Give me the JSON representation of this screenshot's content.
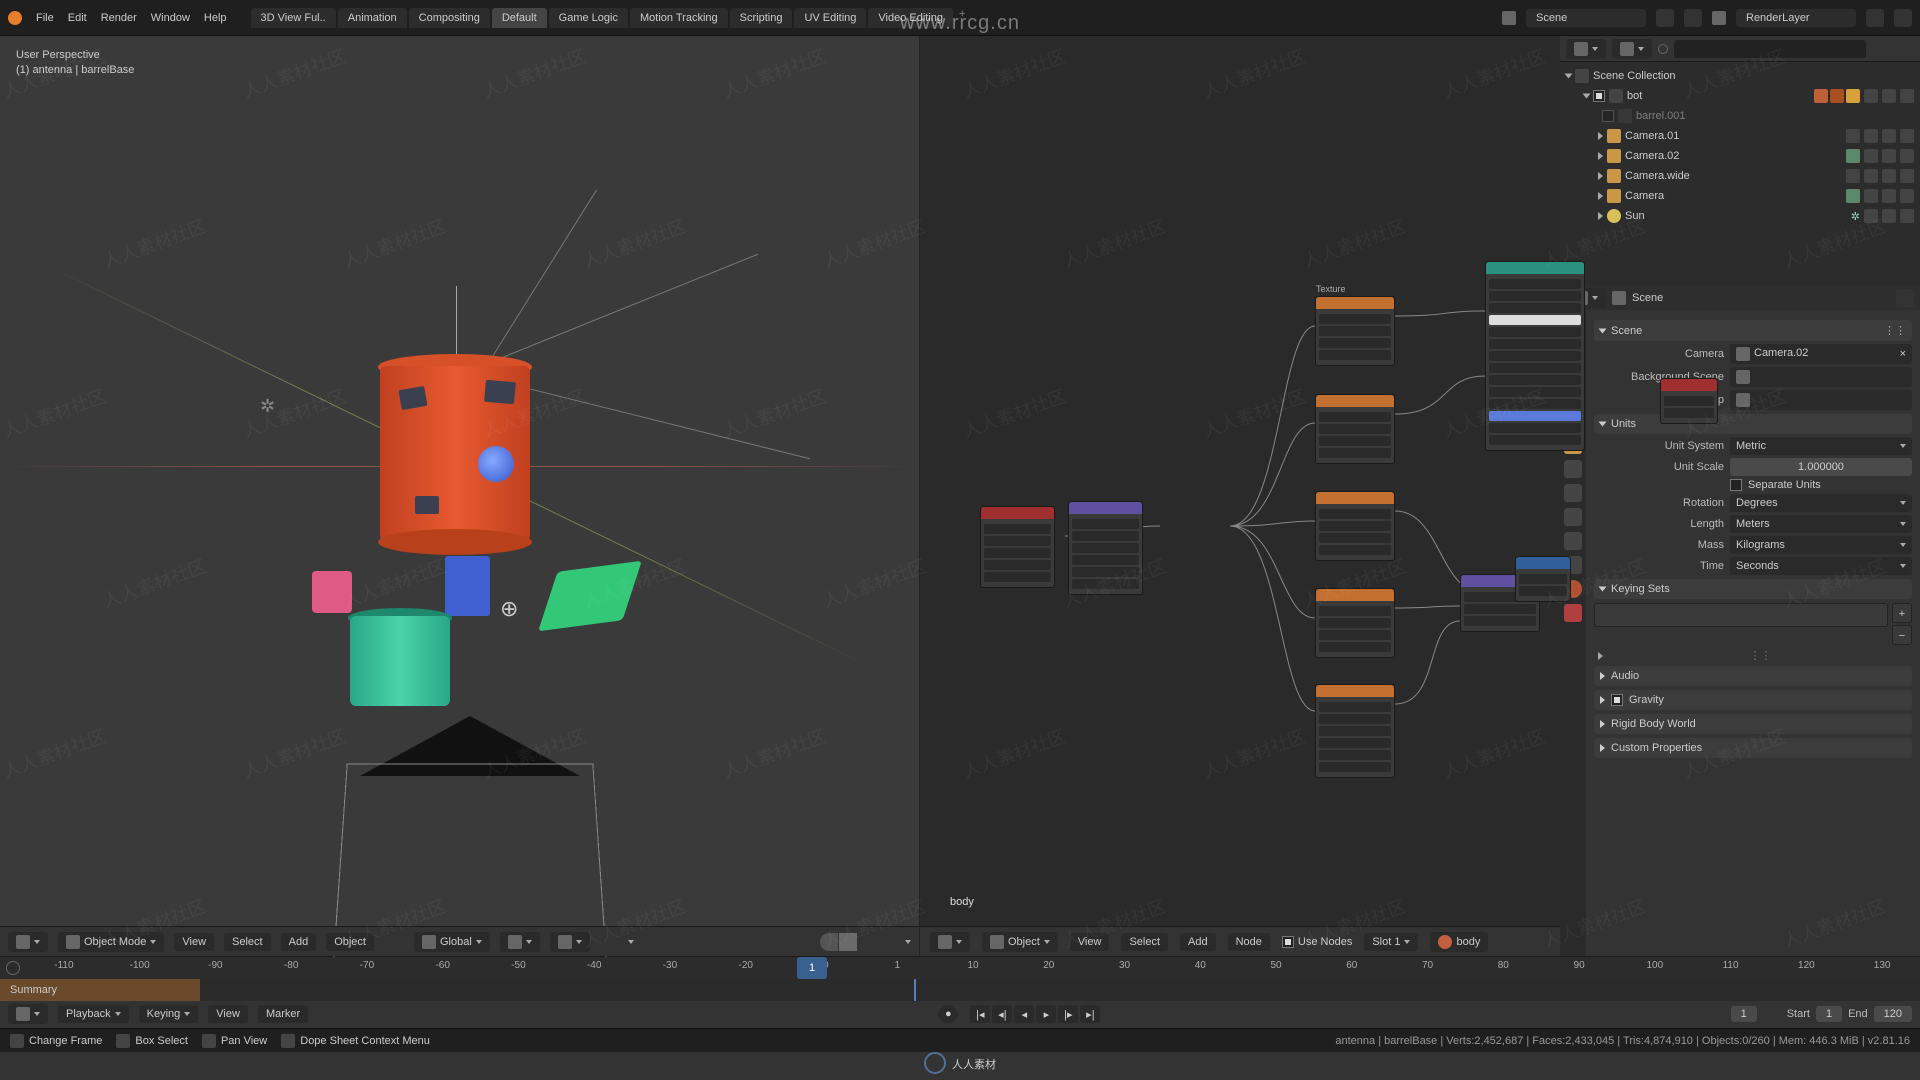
{
  "watermark": {
    "url": "www.rrcg.cn",
    "logo": "人人素材"
  },
  "topbar": {
    "menus": [
      "File",
      "Edit",
      "Render",
      "Window",
      "Help"
    ],
    "workspaces": [
      "3D View Ful..",
      "Animation",
      "Compositing",
      "Default",
      "Game Logic",
      "Motion Tracking",
      "Scripting",
      "UV Editing",
      "Video Editing"
    ],
    "active_workspace": "Default",
    "scene_label": "Scene",
    "renderlayer_label": "RenderLayer"
  },
  "viewport": {
    "persp": "User Perspective",
    "selection": "(1) antenna | barrelBase",
    "header": {
      "mode": "Object Mode",
      "menus": [
        "View",
        "Select",
        "Add",
        "Object"
      ],
      "orientation": "Global"
    }
  },
  "node_editor": {
    "material_label": "body",
    "header": {
      "type": "Object",
      "menus": [
        "View",
        "Select",
        "Add",
        "Node"
      ],
      "use_nodes_label": "Use Nodes",
      "use_nodes": true,
      "slot": "Slot 1",
      "material": "body"
    },
    "group_label": "Texture"
  },
  "outliner": {
    "root": "Scene Collection",
    "items": [
      {
        "indent": 1,
        "name": "bot",
        "checked": true,
        "icons": 3,
        "ctrls": true
      },
      {
        "indent": 2,
        "name": "barrel.001",
        "checked": false,
        "muted": true
      },
      {
        "indent": 2,
        "name": "Camera.01",
        "tri": true,
        "ctrls": true,
        "cam": true
      },
      {
        "indent": 2,
        "name": "Camera.02",
        "tri": true,
        "ctrls": true,
        "cam": true,
        "extra": true
      },
      {
        "indent": 2,
        "name": "Camera.wide",
        "tri": true,
        "ctrls": true,
        "cam": true
      },
      {
        "indent": 2,
        "name": "Camera",
        "tri": true,
        "ctrls": true,
        "cam": true,
        "extra": true
      },
      {
        "indent": 2,
        "name": "Sun",
        "tri": true,
        "ctrls": true,
        "light": true
      }
    ]
  },
  "properties": {
    "context": "Scene",
    "scene_panel": "Scene",
    "camera_label": "Camera",
    "camera_value": "Camera.02",
    "bgscene_label": "Background Scene",
    "activeclip_label": "Active Clip",
    "units_panel": "Units",
    "unit_system_label": "Unit System",
    "unit_system": "Metric",
    "unit_scale_label": "Unit Scale",
    "unit_scale": "1.000000",
    "separate_units": "Separate Units",
    "rotation_label": "Rotation",
    "rotation": "Degrees",
    "length_label": "Length",
    "length": "Meters",
    "mass_label": "Mass",
    "mass": "Kilograms",
    "time_label": "Time",
    "time": "Seconds",
    "keying_panel": "Keying Sets",
    "audio_panel": "Audio",
    "gravity_panel": "Gravity",
    "rigidbody_panel": "Rigid Body World",
    "custom_panel": "Custom Properties"
  },
  "timeline": {
    "ticks": [
      "-110",
      "-100",
      "-90",
      "-80",
      "-70",
      "-60",
      "-50",
      "-40",
      "-30",
      "-20",
      "-10",
      "1",
      "10",
      "20",
      "30",
      "40",
      "50",
      "60",
      "70",
      "80",
      "90",
      "100",
      "110",
      "120",
      "130"
    ],
    "current": "1",
    "summary": "Summary",
    "menus_left": [
      "Playback",
      "Keying",
      "View",
      "Marker"
    ],
    "frame_val": "1",
    "start_label": "Start",
    "start_val": "1",
    "end_label": "End",
    "end_val": "120"
  },
  "status": {
    "left": [
      {
        "icon": "mouse",
        "text": "Change Frame"
      },
      {
        "icon": "mouse",
        "text": "Box Select"
      },
      {
        "icon": "mouse",
        "text": "Pan View"
      },
      {
        "icon": "menu",
        "text": "Dope Sheet Context Menu"
      }
    ],
    "stats": "antenna | barrelBase | Verts:2,452,687 | Faces:2,433,045 | Tris:4,874,910 | Objects:0/260 | Mem: 446.3 MiB | v2.81.16"
  }
}
